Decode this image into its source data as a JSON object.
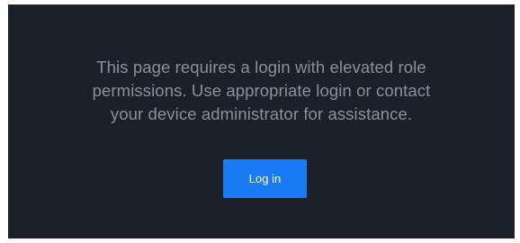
{
  "notice": {
    "line1": "This page requires a login with elevated role",
    "line2": "permissions. Use appropriate login or contact",
    "line3": "your device administrator for assistance."
  },
  "actions": {
    "login_label": "Log in"
  },
  "colors": {
    "panel_background": "#1b202b",
    "message_text": "#8a919c",
    "button_background": "#1a7cf5",
    "button_text": "#ffffff"
  }
}
